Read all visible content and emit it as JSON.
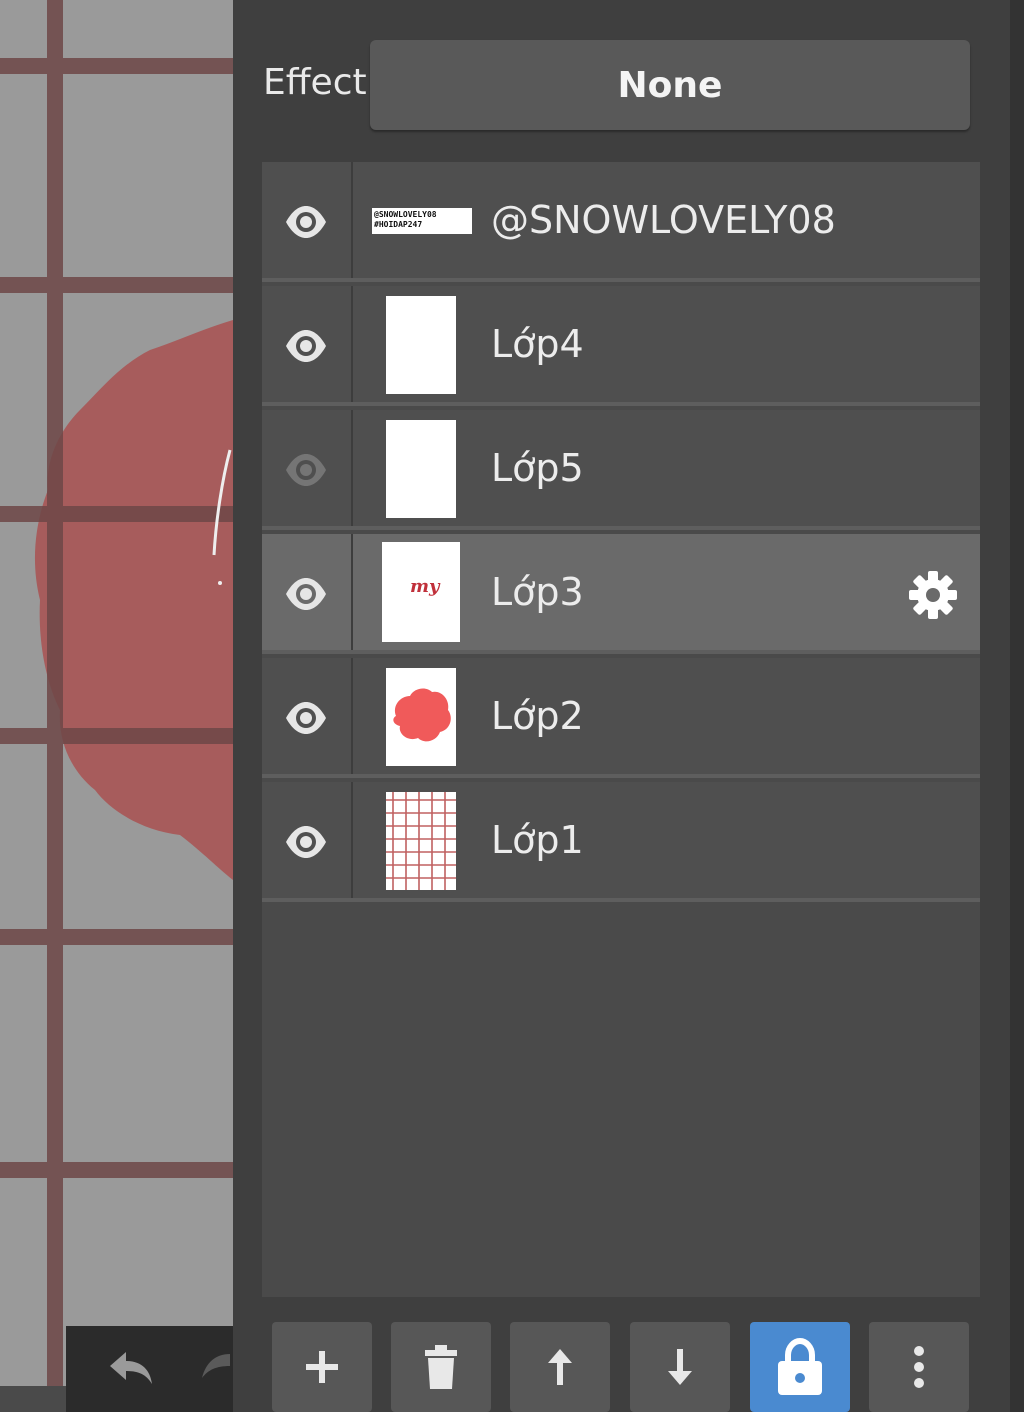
{
  "effect": {
    "label": "Effect",
    "value": "None"
  },
  "layers": [
    {
      "name": "@SNOWLOVELY08",
      "visible": true,
      "thumb_text": [
        "@SNOWLOVELY08",
        "#HOIDAP247"
      ]
    },
    {
      "name": "Lớp4",
      "visible": true
    },
    {
      "name": "Lớp5",
      "visible": false
    },
    {
      "name": "Lớp3",
      "visible": true,
      "selected": true,
      "thumb_text": [
        "my"
      ]
    },
    {
      "name": "Lớp2",
      "visible": true
    },
    {
      "name": "Lớp1",
      "visible": true
    }
  ],
  "toolbar": {
    "buttons": [
      {
        "icon": "plus-icon"
      },
      {
        "icon": "trash-icon"
      },
      {
        "icon": "arrow-up-icon"
      },
      {
        "icon": "arrow-down-icon"
      },
      {
        "icon": "lock-icon",
        "active": true
      },
      {
        "icon": "more-vertical-icon"
      }
    ]
  },
  "colors": {
    "accent": "#4a8ad0",
    "blob": "#c0504d",
    "grid": "#7a4b4b"
  }
}
